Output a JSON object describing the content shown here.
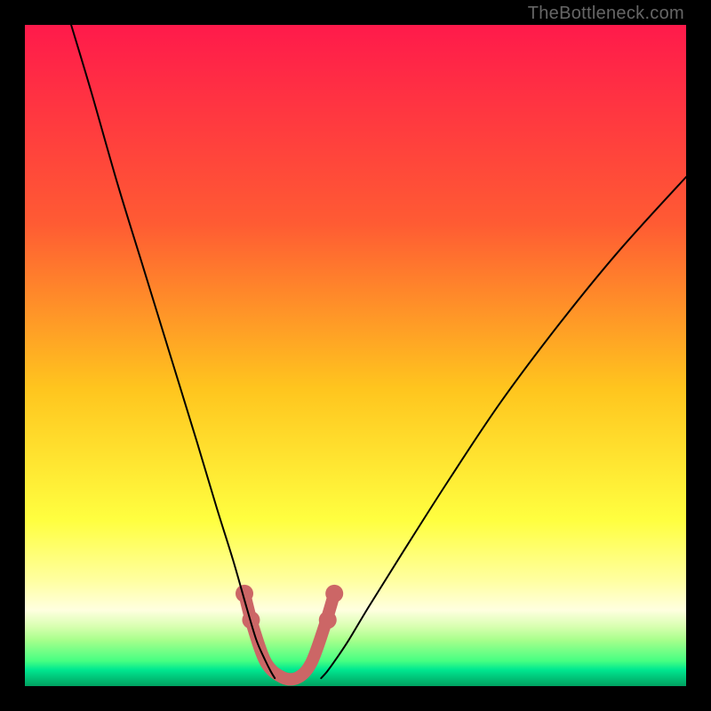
{
  "watermark": "TheBottleneck.com",
  "chart_data": {
    "type": "line",
    "title": "",
    "xlabel": "",
    "ylabel": "",
    "xlim": [
      0,
      100
    ],
    "ylim": [
      0,
      100
    ],
    "background_gradient": {
      "stops": [
        {
          "pos": 0.0,
          "color": "#ff1a4b"
        },
        {
          "pos": 0.3,
          "color": "#ff5b33"
        },
        {
          "pos": 0.55,
          "color": "#ffc51e"
        },
        {
          "pos": 0.75,
          "color": "#ffff40"
        },
        {
          "pos": 0.84,
          "color": "#ffffa0"
        },
        {
          "pos": 0.885,
          "color": "#ffffe0"
        },
        {
          "pos": 0.91,
          "color": "#d8ffb0"
        },
        {
          "pos": 0.93,
          "color": "#a8ff8c"
        },
        {
          "pos": 0.962,
          "color": "#46ff82"
        },
        {
          "pos": 0.975,
          "color": "#00e890"
        },
        {
          "pos": 1.0,
          "color": "#00a060"
        }
      ]
    },
    "series": [
      {
        "name": "left-curve",
        "stroke": "#000000",
        "x": [
          7,
          10,
          14,
          18,
          22,
          26,
          29,
          31.5,
          33.5,
          35,
          36.3,
          37.2,
          37.8
        ],
        "y": [
          100,
          90,
          76,
          63,
          50,
          37,
          27,
          19,
          12,
          7,
          4,
          2.2,
          1.2
        ]
      },
      {
        "name": "right-curve",
        "stroke": "#000000",
        "x": [
          44.8,
          45.7,
          47,
          49,
          52,
          57,
          64,
          72,
          81,
          90,
          100
        ],
        "y": [
          1.2,
          2.2,
          4,
          7,
          12,
          20,
          31,
          43,
          55,
          66,
          77
        ]
      },
      {
        "name": "bottom-hump",
        "stroke": "#cc6666",
        "stroke_width": 14,
        "x": [
          33.2,
          34.5,
          36.5,
          39,
          41.3,
          43.3,
          45.3,
          46.8
        ],
        "y": [
          14,
          9,
          3.5,
          1.3,
          1.3,
          3.5,
          9,
          14
        ]
      }
    ],
    "markers": [
      {
        "x": 33.2,
        "y": 14,
        "r": 10,
        "color": "#cc6666"
      },
      {
        "x": 34.2,
        "y": 10,
        "r": 10,
        "color": "#cc6666"
      },
      {
        "x": 45.8,
        "y": 10,
        "r": 10,
        "color": "#cc6666"
      },
      {
        "x": 46.8,
        "y": 14,
        "r": 10,
        "color": "#cc6666"
      }
    ]
  }
}
